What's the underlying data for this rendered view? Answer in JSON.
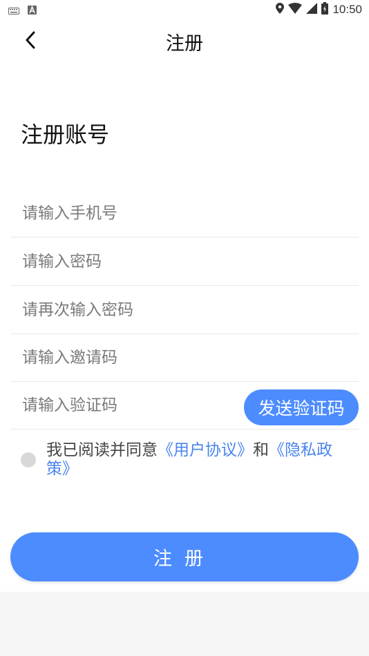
{
  "status_bar": {
    "time": "10:50"
  },
  "nav": {
    "title": "注册"
  },
  "heading": "注册账号",
  "fields": {
    "phone": {
      "placeholder": "请输入手机号",
      "value": ""
    },
    "password": {
      "placeholder": "请输入密码",
      "value": ""
    },
    "confirm_password": {
      "placeholder": "请再次输入密码",
      "value": ""
    },
    "invite_code": {
      "placeholder": "请输入邀请码",
      "value": ""
    },
    "verify_code": {
      "placeholder": "请输入验证码",
      "value": ""
    }
  },
  "send_code_label": "发送验证码",
  "agreement": {
    "prefix": "我已阅读并同意",
    "user_agreement": "《用户协议》",
    "conjunction": "和",
    "privacy_policy": "《隐私政策》"
  },
  "register_label": "注册",
  "colors": {
    "accent": "#4c8cff",
    "link": "#4a84ee"
  }
}
